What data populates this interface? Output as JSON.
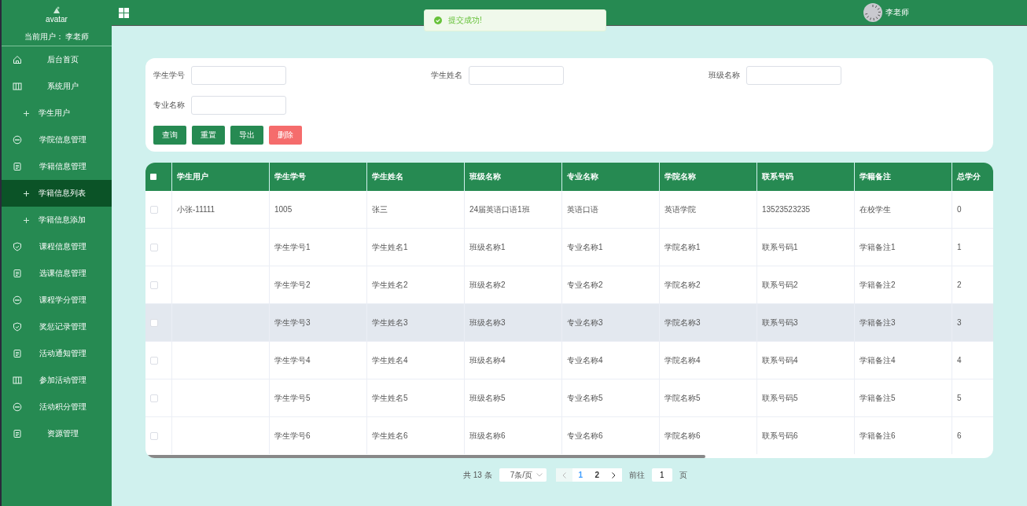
{
  "sidebar": {
    "avatar_alt": "avatar",
    "current_user": "当前用户： 李老师",
    "items": [
      {
        "label": "后台首页",
        "kind": "home",
        "selected": false
      },
      {
        "label": "系统用户",
        "kind": "columns",
        "selected": false
      },
      {
        "label": "学生用户",
        "kind": "sub",
        "selected": false
      },
      {
        "label": "学院信息管理",
        "kind": "chat",
        "selected": false
      },
      {
        "label": "学籍信息管理",
        "kind": "doc",
        "selected": false
      },
      {
        "label": "学籍信息列表",
        "kind": "sub",
        "selected": true
      },
      {
        "label": "学籍信息添加",
        "kind": "sub",
        "selected": false
      },
      {
        "label": "课程信息管理",
        "kind": "shield",
        "selected": false
      },
      {
        "label": "选课信息管理",
        "kind": "doc",
        "selected": false
      },
      {
        "label": "课程学分管理",
        "kind": "chat",
        "selected": false
      },
      {
        "label": "奖惩记录管理",
        "kind": "shield",
        "selected": false
      },
      {
        "label": "活动通知管理",
        "kind": "doc",
        "selected": false
      },
      {
        "label": "参加活动管理",
        "kind": "columns",
        "selected": false
      },
      {
        "label": "活动积分管理",
        "kind": "chat",
        "selected": false
      },
      {
        "label": "资源管理",
        "kind": "doc",
        "selected": false
      }
    ]
  },
  "topbar": {
    "user": "李老师"
  },
  "toast": {
    "message": "提交成功!"
  },
  "search": {
    "fields": [
      {
        "label": "学生学号"
      },
      {
        "label": "学生姓名"
      },
      {
        "label": "班级名称"
      },
      {
        "label": "专业名称"
      }
    ],
    "buttons": [
      {
        "label": "查询",
        "kind": "primary"
      },
      {
        "label": "重置",
        "kind": "primary"
      },
      {
        "label": "导出",
        "kind": "primary"
      },
      {
        "label": "删除",
        "kind": "danger"
      }
    ]
  },
  "table": {
    "all_checked": false,
    "columns": [
      "学生用户",
      "学生学号",
      "学生姓名",
      "班级名称",
      "专业名称",
      "学院名称",
      "联系号码",
      "学籍备注",
      "总学分"
    ],
    "rows": [
      {
        "checked": false,
        "hovered": false,
        "cells": [
          "小张-11111",
          "1005",
          "张三",
          "24届英语口语1班",
          "英语口语",
          "英语学院",
          "13523523235",
          "在校学生",
          "0"
        ]
      },
      {
        "checked": false,
        "hovered": false,
        "cells": [
          "",
          "学生学号1",
          "学生姓名1",
          "班级名称1",
          "专业名称1",
          "学院名称1",
          "联系号码1",
          "学籍备注1",
          "1"
        ]
      },
      {
        "checked": false,
        "hovered": false,
        "cells": [
          "",
          "学生学号2",
          "学生姓名2",
          "班级名称2",
          "专业名称2",
          "学院名称2",
          "联系号码2",
          "学籍备注2",
          "2"
        ]
      },
      {
        "checked": false,
        "hovered": true,
        "cells": [
          "",
          "学生学号3",
          "学生姓名3",
          "班级名称3",
          "专业名称3",
          "学院名称3",
          "联系号码3",
          "学籍备注3",
          "3"
        ]
      },
      {
        "checked": false,
        "hovered": false,
        "cells": [
          "",
          "学生学号4",
          "学生姓名4",
          "班级名称4",
          "专业名称4",
          "学院名称4",
          "联系号码4",
          "学籍备注4",
          "4"
        ]
      },
      {
        "checked": false,
        "hovered": false,
        "cells": [
          "",
          "学生学号5",
          "学生姓名5",
          "班级名称5",
          "专业名称5",
          "学院名称5",
          "联系号码5",
          "学籍备注5",
          "5"
        ]
      },
      {
        "checked": false,
        "hovered": false,
        "cells": [
          "",
          "学生学号6",
          "学生姓名6",
          "班级名称6",
          "专业名称6",
          "学院名称6",
          "联系号码6",
          "学籍备注6",
          "6"
        ]
      }
    ]
  },
  "pagination": {
    "total": "共 13 条",
    "page_size": "7条/页",
    "pages": [
      {
        "label": "1",
        "selected": true
      },
      {
        "label": "2",
        "selected": false
      }
    ],
    "goto_label": "前往",
    "goto_value": "1",
    "goto_suffix": "页"
  }
}
